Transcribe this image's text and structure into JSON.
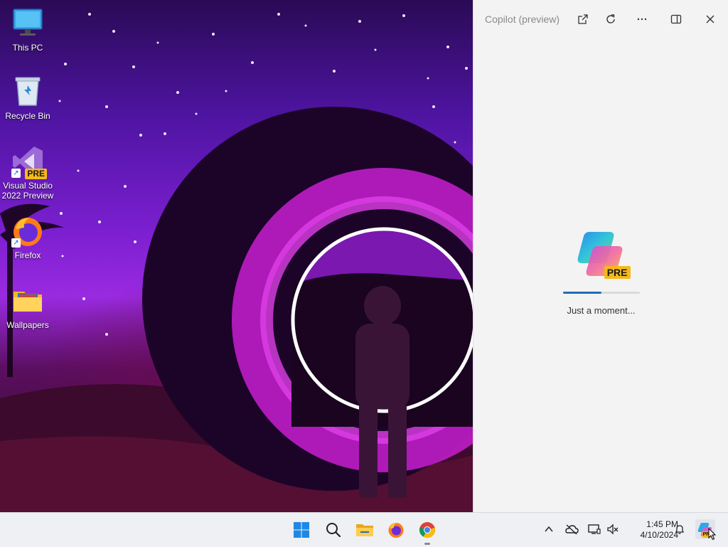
{
  "desktop": {
    "icons": [
      {
        "label": "This PC"
      },
      {
        "label": "Recycle Bin"
      },
      {
        "label": "Visual Studio 2022 Preview",
        "badge": "PRE"
      },
      {
        "label": "Firefox"
      },
      {
        "label": "Wallpapers"
      }
    ]
  },
  "copilot": {
    "title": "Copilot (preview)",
    "badge": "PRE",
    "status": "Just a moment...",
    "progress": 0.5,
    "buttons": [
      "open-external-icon",
      "refresh-icon",
      "more-icon",
      "dock-panel-icon",
      "close-icon"
    ]
  },
  "taskbar": {
    "apps": [
      "windows-start-icon",
      "search-icon",
      "file-explorer-icon",
      "firefox-icon",
      "chrome-icon"
    ],
    "tray": [
      "chevron-up-icon",
      "onedrive-offline-icon",
      "display-icon",
      "network-icon",
      "notification-bell-icon",
      "copilot-icon"
    ],
    "time": "1:45 PM",
    "date": "4/10/2024",
    "copilot_badge": "PRE"
  },
  "colors": {
    "accent": "#1f6fb8",
    "pre_badge": "#f6b91b",
    "panel_bg": "#f3f3f3",
    "taskbar_bg": "#eef0f4"
  }
}
